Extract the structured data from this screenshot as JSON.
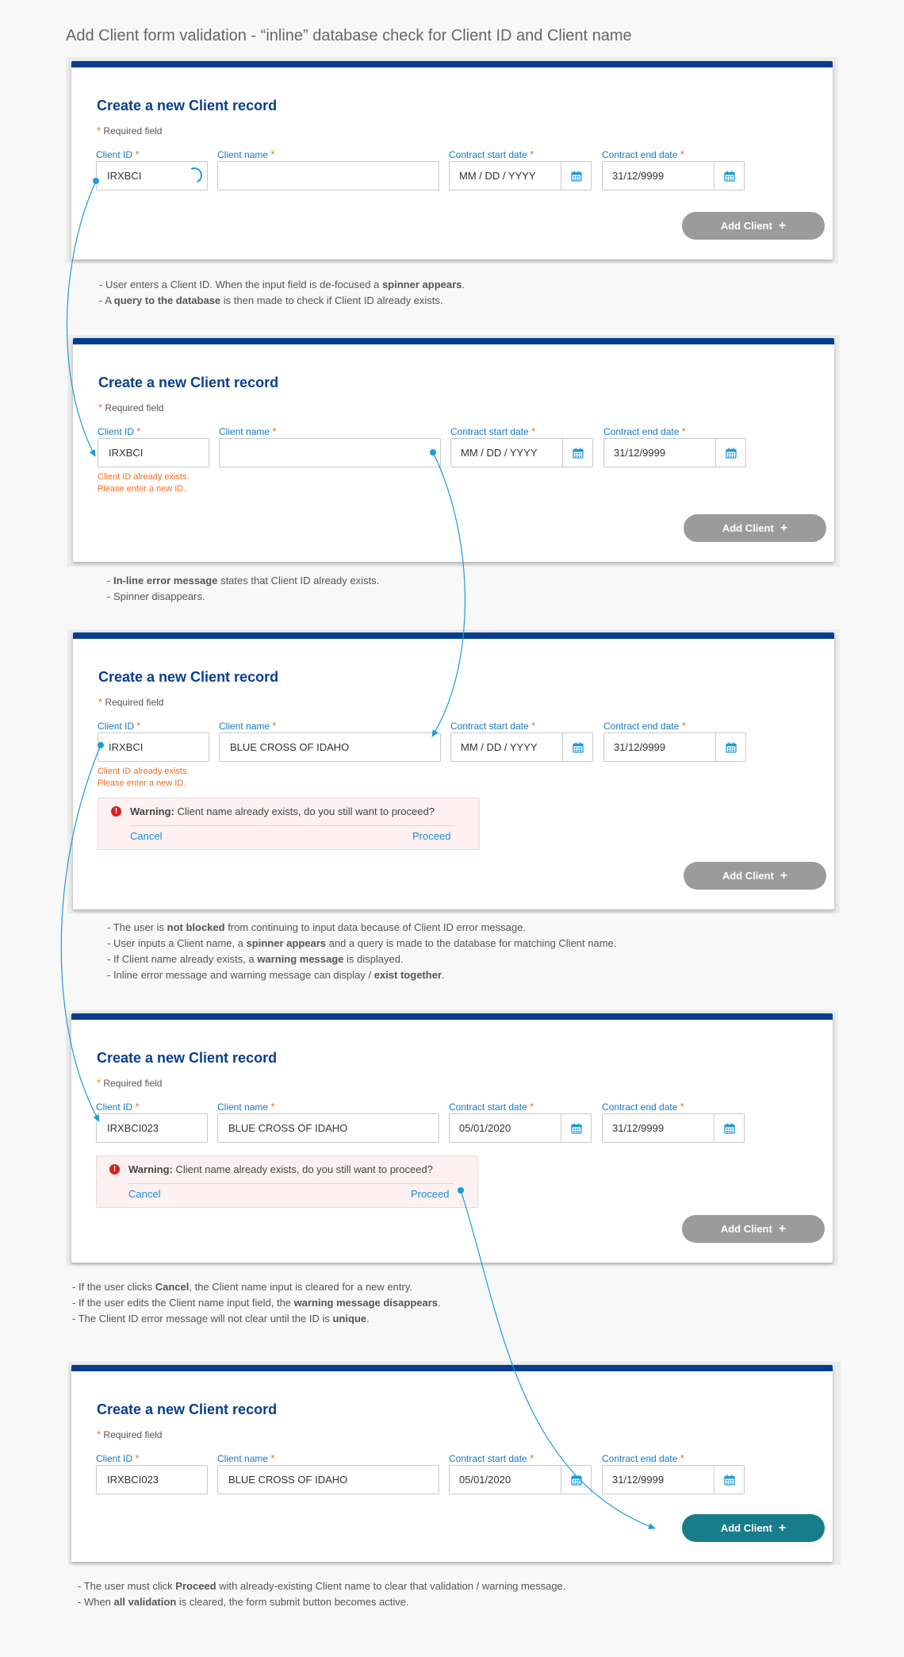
{
  "page_title": "Add Client form validation - “inline” database check for Client ID and Client name",
  "common": {
    "card_title": "Create a new Client record",
    "required_star": "*",
    "required_text": "Required field",
    "label_client_id": "Client ID",
    "label_client_name": "Client name",
    "label_start_date": "Contract start date",
    "label_end_date": "Contract end date",
    "date_placeholder": "MM / DD / YYYY",
    "end_date_value": "31/12/9999",
    "add_button": "Add Client",
    "add_plus": "+",
    "error_line1": "Client ID already exists.",
    "error_line2": "Please enter a new ID.",
    "warning_bold": "Warning:",
    "warning_text": " Client name already exists, do you still want to proceed?",
    "warning_icon": "!",
    "cancel": "Cancel",
    "proceed": "Proceed"
  },
  "steps": [
    {
      "client_id": "IRXBCI",
      "client_name": "",
      "start_date": "",
      "notes": [
        [
          "- User enters a Client ID.  When the input field is de-focused a ",
          "spinner appears",
          "."
        ],
        [
          "- A ",
          "query to the database",
          " is then made to check if Client ID already exists."
        ]
      ]
    },
    {
      "client_id": "IRXBCI",
      "client_name": "",
      "start_date": "",
      "notes": [
        [
          "- ",
          "In-line error message",
          " states that Client ID already exists."
        ],
        [
          "- Spinner disappears.",
          "",
          ""
        ]
      ]
    },
    {
      "client_id": "IRXBCI",
      "client_name": "BLUE CROSS OF IDAHO",
      "start_date": "",
      "notes": [
        [
          "- The user is ",
          "not blocked",
          " from continuing to input data because of Client ID error message."
        ],
        [
          "- User inputs a Client name, a ",
          "spinner appears",
          " and a query is made to the database for matching Client name."
        ],
        [
          "- If Client name already exists, a ",
          "warning message",
          " is displayed."
        ],
        [
          "- Inline error message and warning message can display / ",
          "exist together",
          "."
        ]
      ]
    },
    {
      "client_id": "IRXBCI023",
      "client_name": "BLUE CROSS OF IDAHO",
      "start_date": "05/01/2020",
      "notes": [
        [
          "- If the user clicks ",
          "Cancel",
          ", the Client name input is cleared for a new entry."
        ],
        [
          "- If the user edits the Client name input field, the ",
          "warning message disappears",
          "."
        ],
        [
          "- The Client ID error message will not clear until the ID is ",
          "unique",
          "."
        ]
      ]
    },
    {
      "client_id": "IRXBCI023",
      "client_name": "BLUE CROSS OF IDAHO",
      "start_date": "05/01/2020",
      "notes": [
        [
          "- The user must click ",
          "Proceed",
          " with already-existing Client name to clear that validation / warning message."
        ],
        [
          "- When ",
          "all validation",
          " is cleared, the form submit button becomes active."
        ]
      ]
    }
  ],
  "colors": {
    "header_blue": "#063d8c",
    "title_blue": "#083e8f",
    "label_blue": "#1677c4",
    "required_orange": "#f26a21",
    "arrow_cyan": "#1e9bd7",
    "button_gray": "#9b9b9b",
    "button_teal": "#177d8a",
    "warning_bg": "#fdf1f1",
    "warning_icon_red": "#d91f1f"
  }
}
